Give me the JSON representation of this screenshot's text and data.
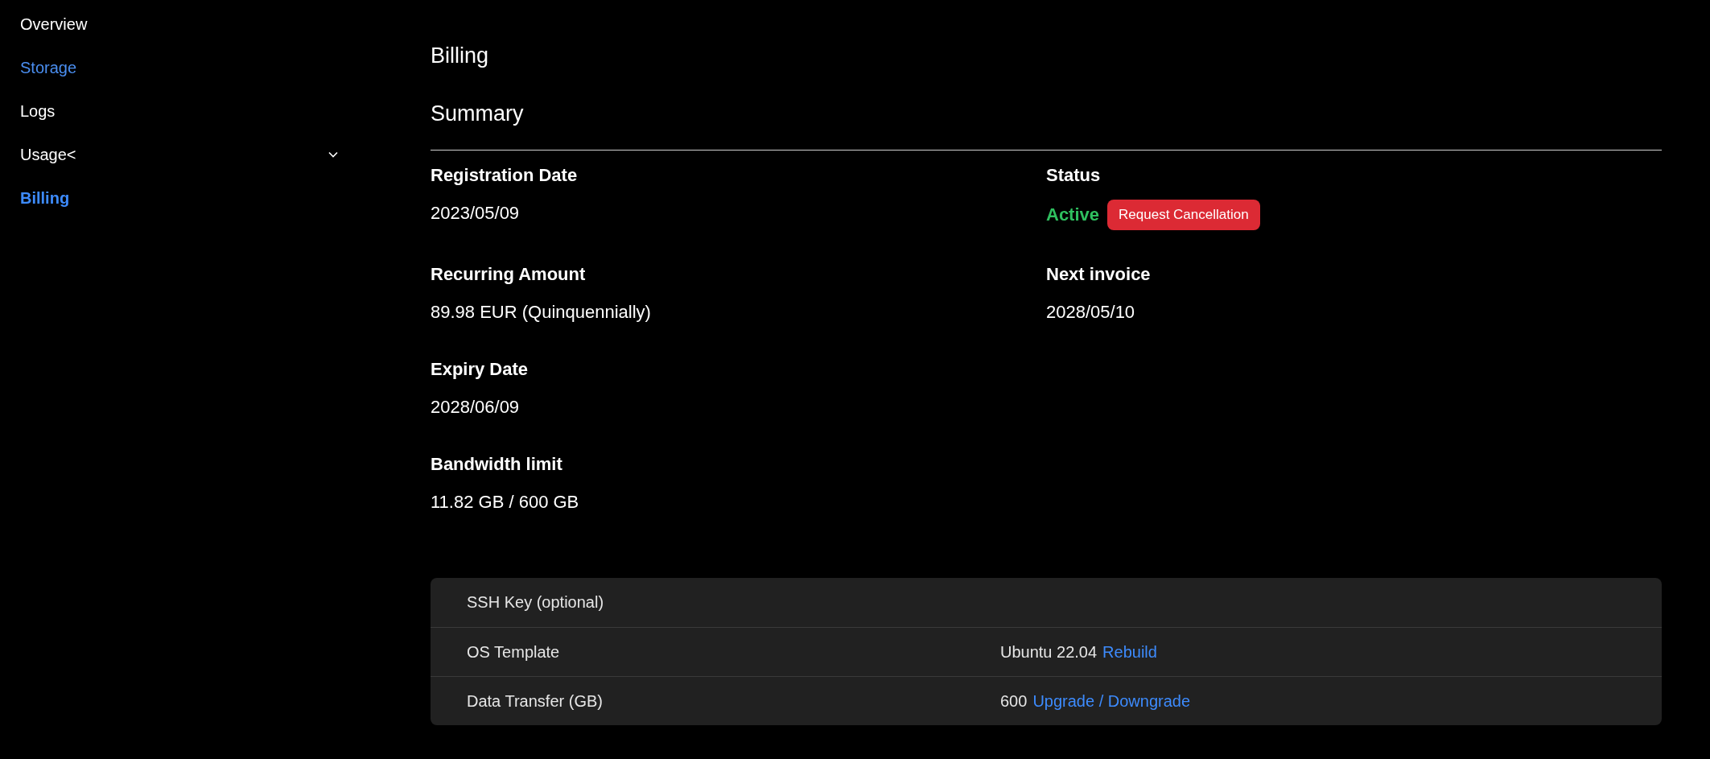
{
  "sidebar": {
    "items": [
      {
        "label": "Overview",
        "selected": false,
        "highlighted": false
      },
      {
        "label": "Storage",
        "selected": false,
        "highlighted": true
      },
      {
        "label": "Logs",
        "selected": false,
        "highlighted": false
      },
      {
        "label": "Usage<",
        "selected": false,
        "highlighted": false,
        "expanded": false
      },
      {
        "label": "Billing",
        "selected": true,
        "highlighted": false
      }
    ]
  },
  "page_title": "Billing",
  "summary": {
    "title": "Summary",
    "rows": [
      {
        "cells": [
          {
            "kind": "text",
            "label": "Registration Date",
            "value": "2023/05/09"
          },
          {
            "kind": "status",
            "label": "Status",
            "value": "Active",
            "color": "#2fbf5f",
            "action": "Request Cancellation"
          }
        ]
      },
      {
        "cells": [
          {
            "kind": "text",
            "label": "Recurring Amount",
            "value": "89.98 EUR (Quinquennially)"
          },
          {
            "kind": "text",
            "label": "Next invoice",
            "value": "2028/05/10"
          }
        ]
      },
      {
        "cells": [
          {
            "kind": "text",
            "label": "Expiry Date",
            "value": "2028/06/09"
          }
        ]
      },
      {
        "cells": [
          {
            "kind": "text",
            "label": "Bandwidth limit",
            "value": "11.82 GB / 600 GB"
          }
        ]
      }
    ]
  },
  "table": {
    "rows": [
      {
        "label": "SSH Key (optional)"
      },
      {
        "label": "OS Template",
        "value": "Ubuntu 22.04",
        "link": "Rebuild"
      },
      {
        "label": "Data Transfer (GB)",
        "value": "600",
        "link": "Upgrade / Downgrade"
      }
    ]
  }
}
